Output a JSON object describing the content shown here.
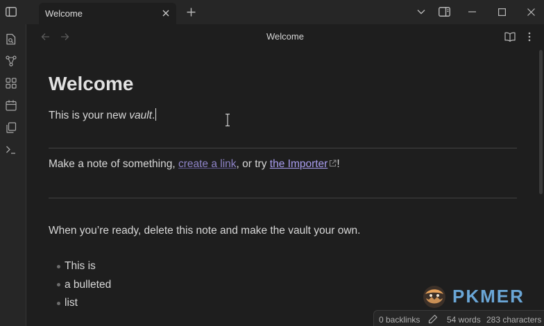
{
  "window": {
    "tab_label": "Welcome"
  },
  "view": {
    "title": "Welcome"
  },
  "note": {
    "heading": "Welcome",
    "intro_text": "This is your new ",
    "intro_emphasis": "vault",
    "intro_end": ".",
    "line2_start": "Make a note of something, ",
    "internal_link": "create a link",
    "line2_mid": ", or try ",
    "external_link": "the Importer",
    "line2_end": "!",
    "ready_text": "When you’re ready, delete this note and make the vault your own.",
    "bullets": [
      "This is",
      "a bulleted",
      "list"
    ]
  },
  "status": {
    "backlinks": "0 backlinks",
    "words": "54 words",
    "characters": "283 characters"
  },
  "watermark": {
    "text": "PKMER"
  },
  "colors": {
    "background": "#1e1e1e",
    "chrome": "#262626",
    "internal_link": "#8f84c9",
    "external_link": "#a99df0"
  }
}
